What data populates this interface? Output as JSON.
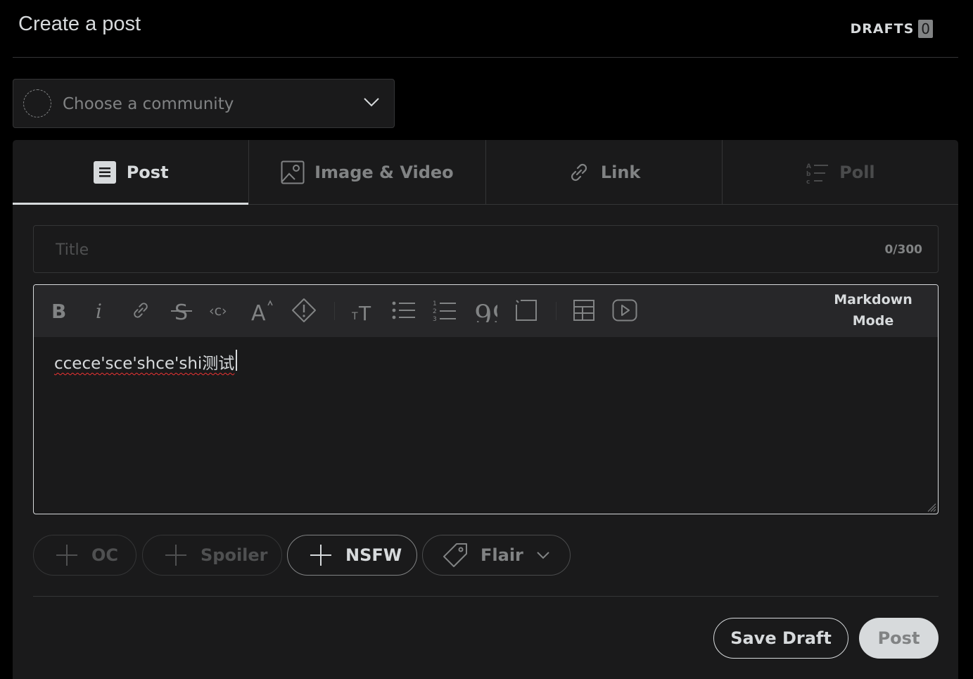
{
  "header": {
    "title": "Create a post",
    "drafts_label": "DRAFTS",
    "drafts_count": "0"
  },
  "community": {
    "placeholder": "Choose a community"
  },
  "tabs": [
    {
      "label": "Post",
      "icon": "post-icon",
      "active": true
    },
    {
      "label": "Image & Video",
      "icon": "image-icon"
    },
    {
      "label": "Link",
      "icon": "link-icon"
    },
    {
      "label": "Poll",
      "icon": "poll-icon",
      "disabled": true
    }
  ],
  "title_field": {
    "placeholder": "Title",
    "value": "",
    "counter": "0/300"
  },
  "editor": {
    "toolbar": [
      "bold-icon",
      "italic-icon",
      "link-icon",
      "strikethrough-icon",
      "inline-code-icon",
      "superscript-icon",
      "spoiler-icon",
      "heading-icon",
      "bulleted-list-icon",
      "numbered-list-icon",
      "quote-icon",
      "code-block-icon",
      "table-icon",
      "embed-video-icon"
    ],
    "markdown_line1": "Markdown",
    "markdown_line2": "Mode",
    "body_text": "ccece'sce'shce'shi测试"
  },
  "tags": {
    "oc": "OC",
    "spoiler": "Spoiler",
    "nsfw": "NSFW",
    "flair": "Flair"
  },
  "actions": {
    "save_draft": "Save Draft",
    "post": "Post"
  },
  "colors": {
    "background": "#000000",
    "surface": "#1a1a1b",
    "toolbar": "#272729",
    "text": "#d7dadc",
    "muted": "#818384",
    "border": "#343536"
  }
}
